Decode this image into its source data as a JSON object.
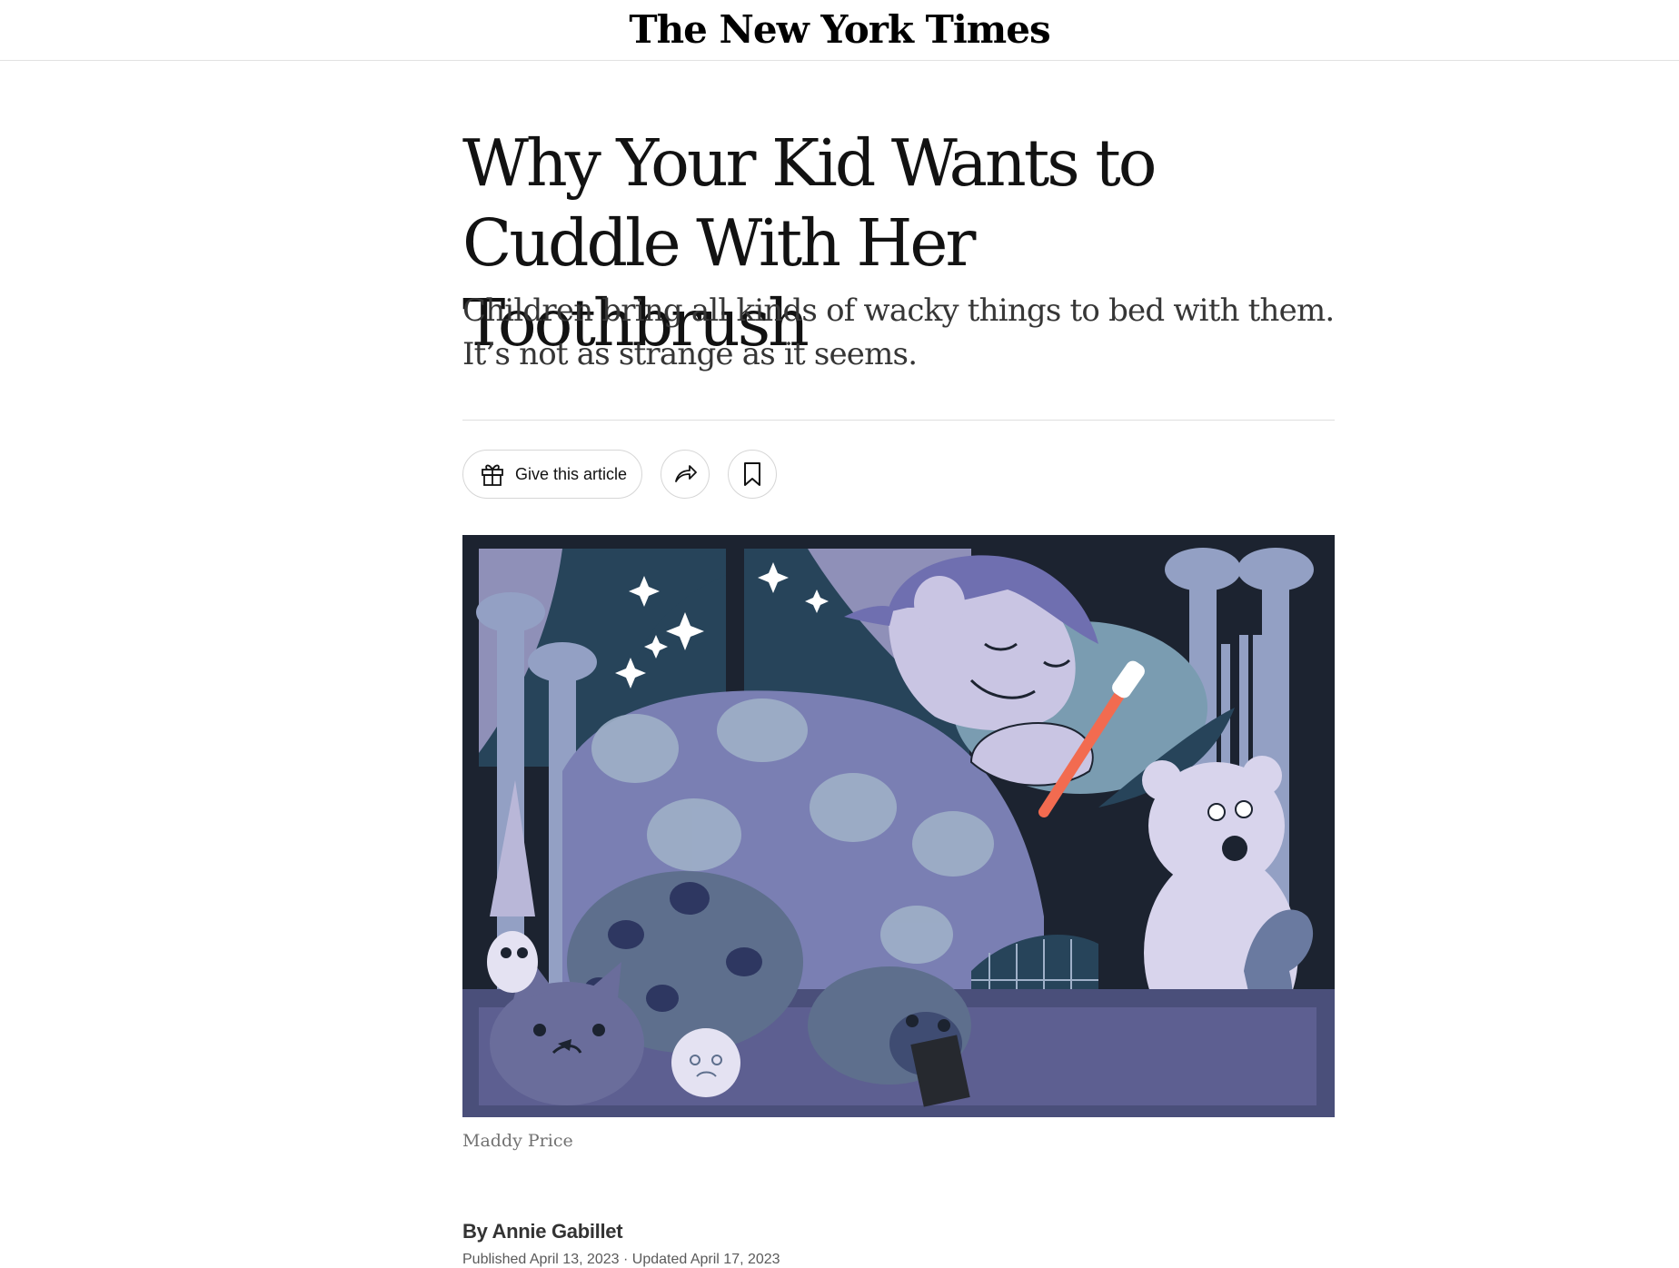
{
  "header": {
    "logo_text": "The New York Times"
  },
  "article": {
    "headline": "Why Your Kid Wants to Cuddle With Her Toothbrush",
    "summary": "Children bring all kinds of wacky things to bed with them. It’s not as strange as it seems.",
    "toolbar": {
      "give_label": "Give this article",
      "give_icon": "gift-icon",
      "share_icon": "share-arrow-icon",
      "save_icon": "bookmark-icon"
    },
    "image_credit": "Maddy Price",
    "byline": "By Annie Gabillet",
    "timestamp": "Published April 13, 2023 · Updated April 17, 2023"
  },
  "colors": {
    "text": "#121212",
    "illustration_dark": "#1c2330",
    "illustration_blue": "#7a7fb3",
    "illustration_lilac": "#c9c5e3",
    "toothbrush": "#f26b50"
  }
}
